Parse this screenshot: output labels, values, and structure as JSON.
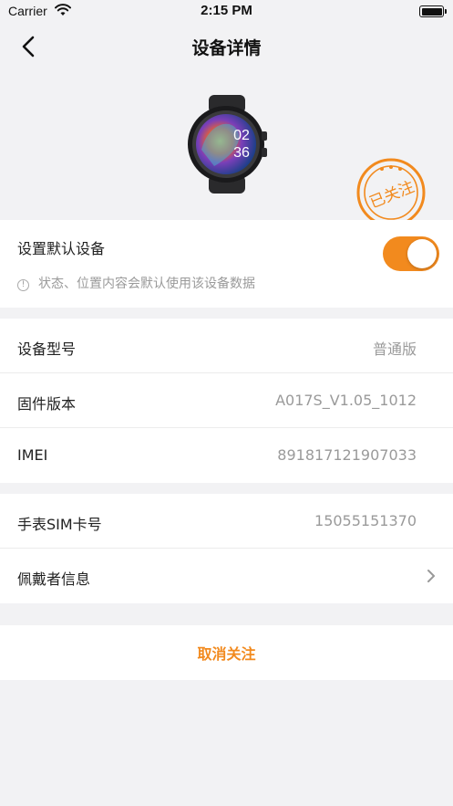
{
  "status_bar": {
    "carrier": "Carrier",
    "time": "2:15 PM"
  },
  "nav": {
    "title": "设备详情"
  },
  "device": {
    "stamp_text": "已关注",
    "watch_time_hour": "02",
    "watch_time_min": "36"
  },
  "default_device": {
    "label": "设置默认设备",
    "toggle_on": true,
    "hint": "状态、位置内容会默认使用该设备数据"
  },
  "info": [
    {
      "label": "设备型号",
      "value": "普通版"
    },
    {
      "label": "固件版本",
      "value": "A017S_V1.05_1012"
    },
    {
      "label": "IMEI",
      "value": "891817121907033"
    }
  ],
  "sim": {
    "label": "手表SIM卡号",
    "value": "15055151370"
  },
  "wearer": {
    "label": "佩戴者信息"
  },
  "cancel": {
    "label": "取消关注"
  },
  "colors": {
    "accent": "#f28a1e",
    "background": "#f2f2f4"
  }
}
